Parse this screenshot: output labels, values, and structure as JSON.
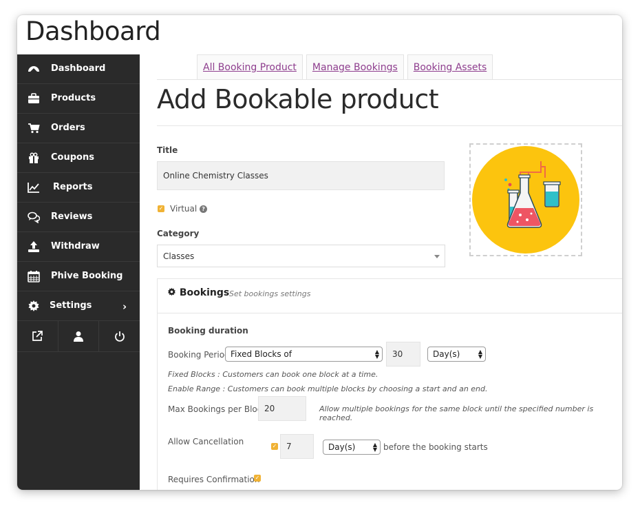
{
  "header": {
    "title": "Dashboard"
  },
  "sidebar": {
    "items": [
      {
        "label": "Dashboard",
        "icon": "dashboard-gauge-icon"
      },
      {
        "label": "Products",
        "icon": "briefcase-icon"
      },
      {
        "label": "Orders",
        "icon": "cart-icon"
      },
      {
        "label": "Coupons",
        "icon": "gift-icon"
      },
      {
        "label": "Reports",
        "icon": "line-chart-icon"
      },
      {
        "label": "Reviews",
        "icon": "comments-icon"
      },
      {
        "label": "Withdraw",
        "icon": "upload-icon"
      },
      {
        "label": "Phive Booking",
        "icon": "calendar-icon"
      },
      {
        "label": "Settings",
        "icon": "gear-icon"
      }
    ],
    "bottom_icons": [
      "external-link-icon",
      "user-icon",
      "power-icon"
    ]
  },
  "tabs": [
    {
      "label": "All Booking Product"
    },
    {
      "label": "Manage Bookings"
    },
    {
      "label": "Booking Assets"
    }
  ],
  "page_title": "Add Bookable product",
  "form": {
    "title_label": "Title",
    "title_value": "Online Chemistry Classes",
    "virtual_label": "Virtual",
    "category_label": "Category",
    "category_value": "Classes"
  },
  "product_image": {
    "icon": "chemistry-flasks-icon"
  },
  "bookings": {
    "heading": "Bookings",
    "subheading": "Set bookings settings",
    "duration_label": "Booking duration",
    "period_label": "Booking Period",
    "period_type": "Fixed Blocks of",
    "period_value": "30",
    "period_unit": "Day(s)",
    "note_fixed": "Fixed Blocks : Customers can book one block at a time.",
    "note_range": "Enable Range : Customers can book multiple blocks by choosing a start and an end.",
    "max_label": "Max Bookings per Block",
    "max_value": "20",
    "max_note": "Allow multiple bookings for the same block until the specified number is reached.",
    "cancel_label": "Allow Cancellation",
    "cancel_value": "7",
    "cancel_unit": "Day(s)",
    "cancel_suffix": "before the booking starts",
    "confirm_label": "Requires Confirmation"
  },
  "colors": {
    "sidebar_bg": "#2a2a2a",
    "tab_link": "#8e3e8e",
    "checkbox": "#f0b234",
    "image_bg": "#fcc40e"
  }
}
